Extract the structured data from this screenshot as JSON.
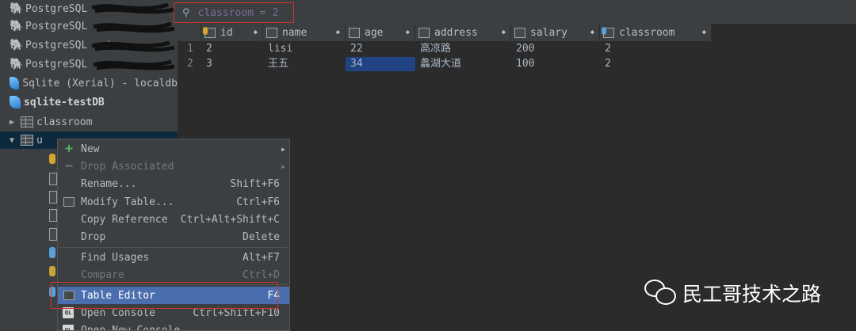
{
  "sidebar": {
    "items": [
      {
        "label": "PostgreSQL - ",
        "icon": "postgresql-icon"
      },
      {
        "label": "PostgreSQL - ",
        "icon": "postgresql-icon"
      },
      {
        "label": "PostgreSQL - te",
        "icon": "postgresql-icon"
      },
      {
        "label": "PostgreSQL - ",
        "icon": "postgresql-icon"
      },
      {
        "label": "Sqlite (Xerial) - localdb",
        "icon": "sqlite-icon"
      },
      {
        "label": "sqlite-testDB",
        "icon": "sqlite-icon"
      },
      {
        "label": "classroom",
        "icon": "table-icon"
      },
      {
        "label": "u",
        "icon": "table-icon"
      }
    ]
  },
  "filter": {
    "text": "classroom = 2",
    "icon": "filter-icon"
  },
  "grid": {
    "columns": [
      {
        "name": "id",
        "icon": "primary-key-column-icon"
      },
      {
        "name": "name",
        "icon": "column-icon"
      },
      {
        "name": "age",
        "icon": "column-icon"
      },
      {
        "name": "address",
        "icon": "column-icon"
      },
      {
        "name": "salary",
        "icon": "column-icon"
      },
      {
        "name": "classroom",
        "icon": "foreign-key-column-icon"
      }
    ],
    "rows": [
      {
        "num": "1",
        "id": "2",
        "name": "lisi",
        "age": "22",
        "address": "高凉路",
        "salary": "200",
        "classroom": "2"
      },
      {
        "num": "2",
        "id": "3",
        "name": "王五",
        "age": "34",
        "address": "蠡湖大道",
        "salary": "100",
        "classroom": "2"
      }
    ]
  },
  "context_menu": {
    "items": [
      {
        "label": "New",
        "shortcut": "",
        "submenu": true,
        "disabled": false,
        "icon": "plus-icon"
      },
      {
        "label": "Drop Associated",
        "shortcut": "",
        "submenu": true,
        "disabled": true,
        "icon": "minus-icon"
      },
      {
        "label": "Rename...",
        "shortcut": "Shift+F6",
        "disabled": false
      },
      {
        "label": "Modify Table...",
        "shortcut": "Ctrl+F6",
        "disabled": false,
        "icon": "table-icon"
      },
      {
        "label": "Copy Reference",
        "shortcut": "Ctrl+Alt+Shift+C",
        "disabled": false
      },
      {
        "label": "Drop",
        "shortcut": "Delete",
        "disabled": false
      },
      {
        "label": "Find Usages",
        "shortcut": "Alt+F7",
        "disabled": false
      },
      {
        "label": "Compare",
        "shortcut": "Ctrl+D",
        "disabled": true
      },
      {
        "label": "Table Editor",
        "shortcut": "F4",
        "disabled": false,
        "active": true,
        "icon": "table-icon"
      },
      {
        "label": "Open Console",
        "shortcut": "Ctrl+Shift+F10",
        "disabled": false,
        "icon": "ql-console-icon"
      },
      {
        "label": "Open New Console",
        "shortcut": "",
        "disabled": false,
        "icon": "ql-console-icon"
      }
    ]
  },
  "watermark": {
    "text": "民工哥技术之路"
  },
  "colors": {
    "highlight": "#214283",
    "menu_active": "#4b6eaf",
    "red_outline": "#d0342c"
  }
}
